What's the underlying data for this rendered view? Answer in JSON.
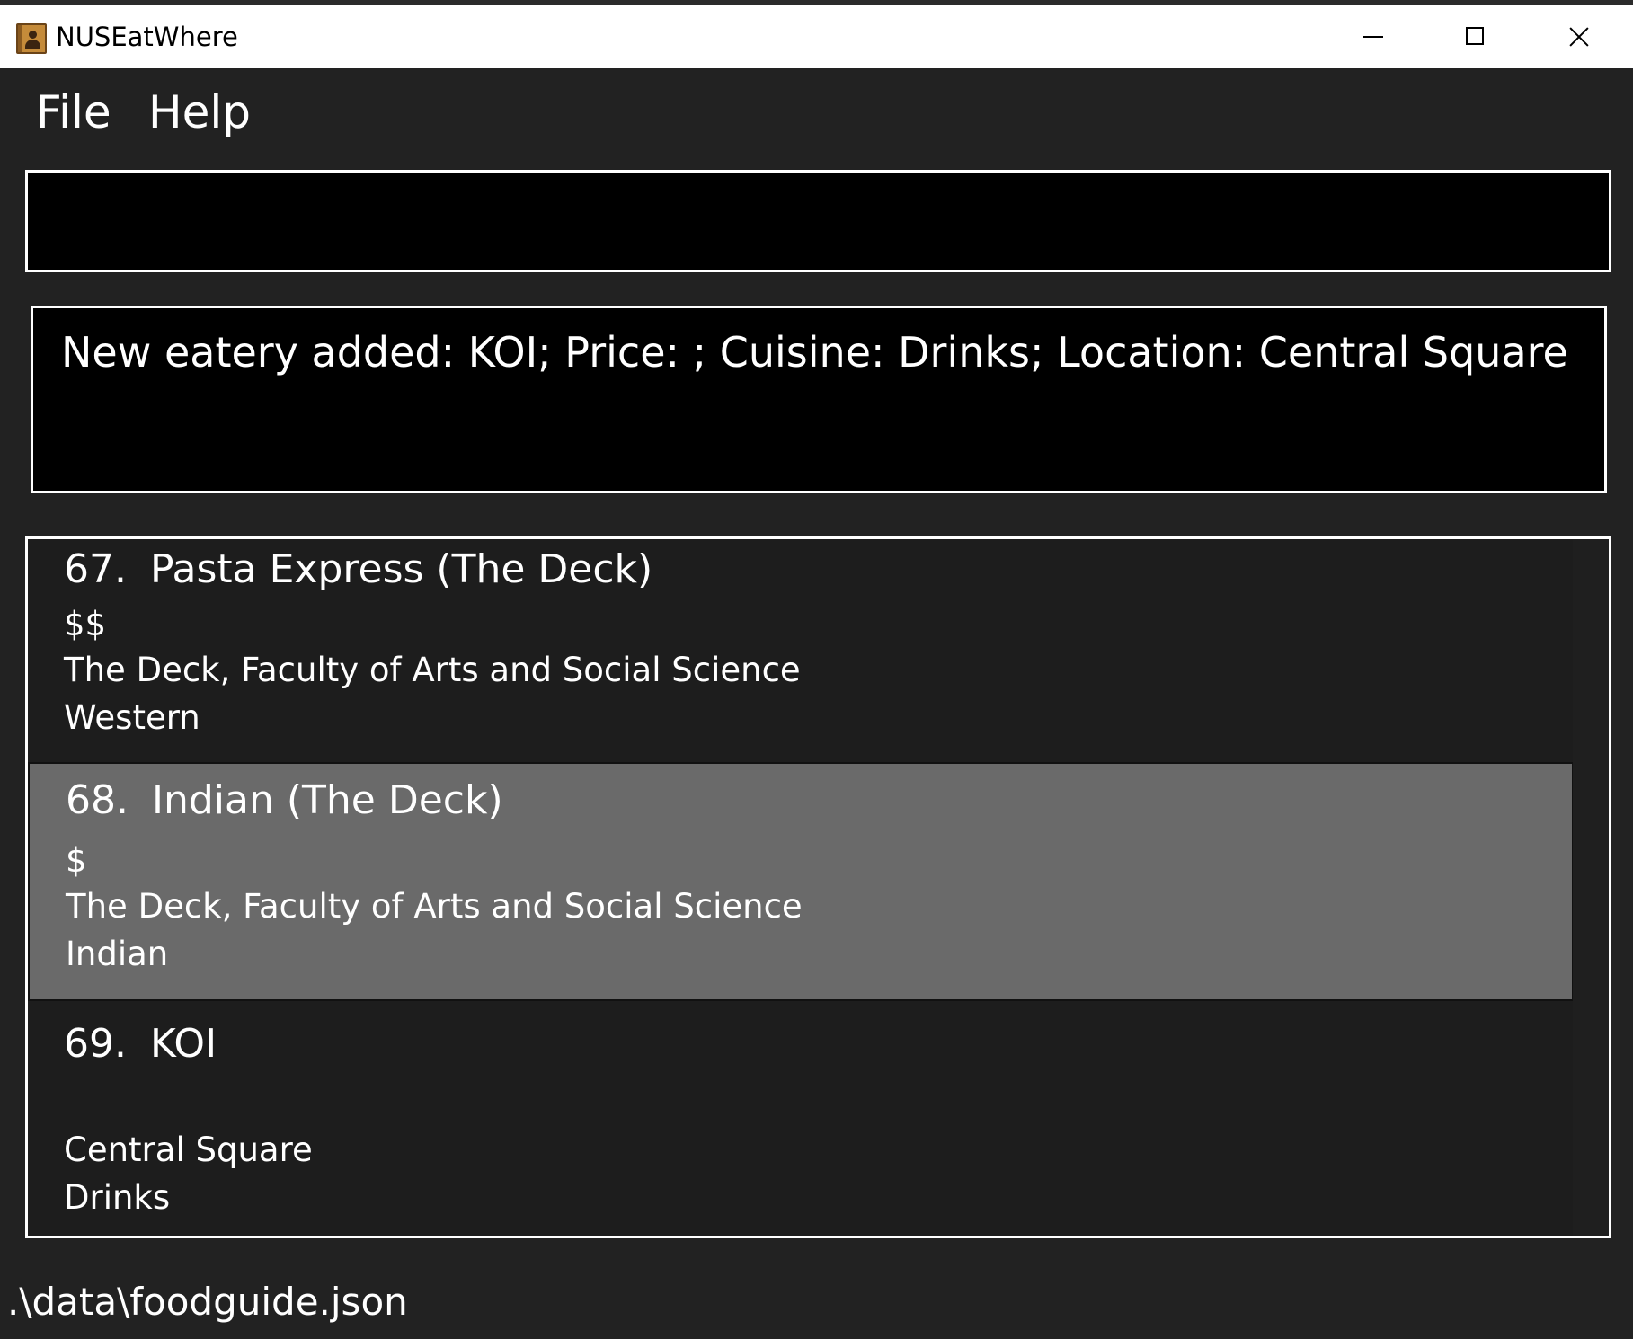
{
  "window": {
    "title": "NUSEatWhere"
  },
  "menu": {
    "file": "File",
    "help": "Help"
  },
  "command": {
    "value": "",
    "placeholder": ""
  },
  "result": {
    "message": "New eatery added: KOI; Price: ; Cuisine: Drinks; Location: Central Square"
  },
  "eateries": [
    {
      "index": "67.",
      "name": "Pasta Express (The Deck)",
      "price": "$$",
      "location": "The Deck, Faculty of Arts and Social Science",
      "cuisine": "Western"
    },
    {
      "index": "68.",
      "name": "Indian (The Deck)",
      "price": "$",
      "location": "The Deck, Faculty of Arts and Social Science",
      "cuisine": "Indian"
    },
    {
      "index": "69.",
      "name": "KOI",
      "price": "",
      "location": "Central Square",
      "cuisine": "Drinks"
    }
  ],
  "status": {
    "file_path": ".\\data\\foodguide.json"
  },
  "colors": {
    "background": "#222222",
    "panel": "#000000",
    "list_bg": "#1d1d1d",
    "selected": "#6a6a6a",
    "text": "#ffffff"
  }
}
